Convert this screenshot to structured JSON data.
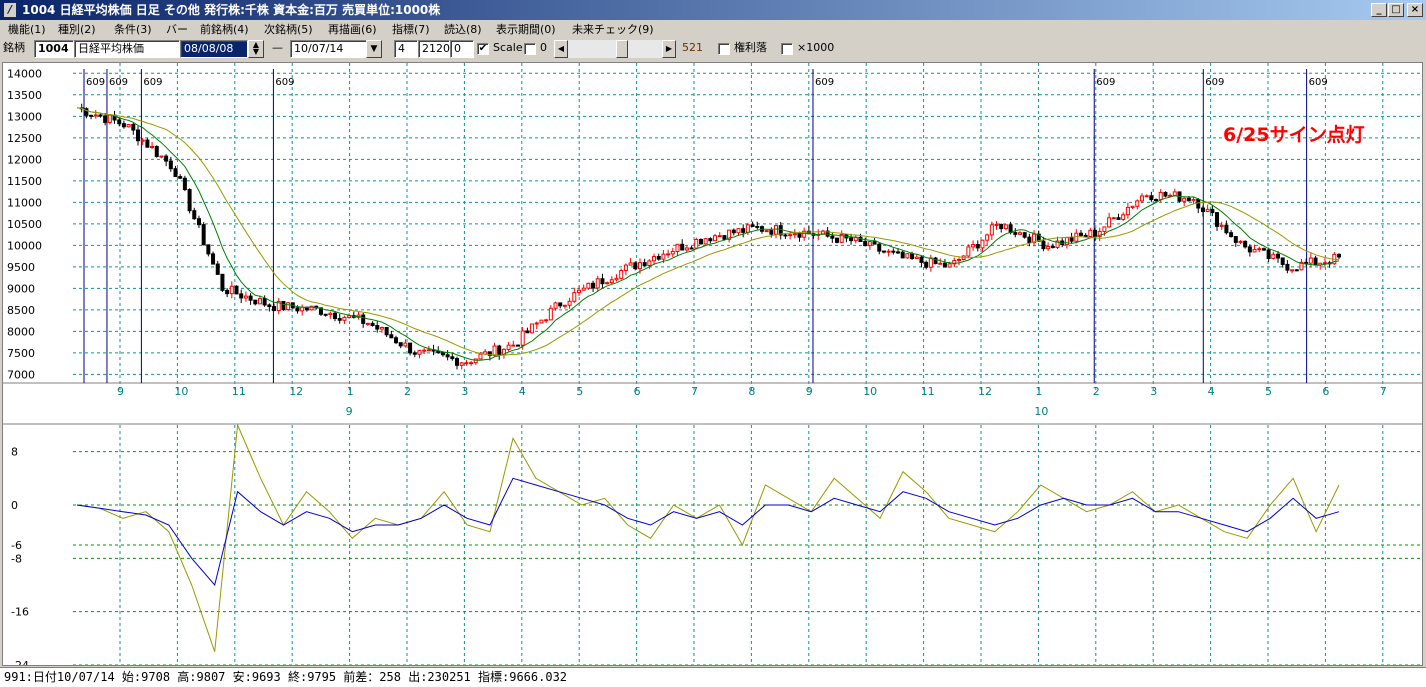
{
  "window": {
    "title": "1004 日経平均株価  日足  その他  発行株:千株  資本金:百万  売買単位:1000株",
    "icon": "chart-app-icon",
    "controls": {
      "minimize": "_",
      "restore": "□",
      "close": "×"
    }
  },
  "menu": [
    "機能(1)",
    "種別(2)",
    "条件(3)",
    "バー",
    "前銘柄(4)",
    "次銘柄(5)",
    "再描画(6)",
    "指標(7)",
    "読込(8)",
    "表示期間(0)",
    "未来チェック(9)"
  ],
  "toolbar": {
    "label_meigara": "銘柄",
    "code": "1004",
    "name": "日経平均株価",
    "start_date": "08/08/08",
    "dash": "—",
    "end_date": "10/07/14",
    "param1": "4",
    "param2": "2120",
    "param3": "0",
    "scale_checked": "✔",
    "scale_label": "Scale",
    "scale_value": "0",
    "scroll_count": "521",
    "kenri_label": "権利落",
    "x1000_label": "×1000"
  },
  "annotation": "6/25サイン点灯",
  "status": "991:日付10/07/14 始:9708 高:9807 安:9693 終:9795 前差：258 出:230251 指標:9666.032",
  "colors": {
    "grid": "#009999",
    "up_candle": "#ff0000",
    "down_candle": "#000000",
    "ma_short": "#008000",
    "ma_long": "#999900",
    "signal_line": "#0000cc",
    "osc_fast": "#999900",
    "osc_slow": "#0000cc",
    "annotation": "#ff0000"
  },
  "chart_data": [
    {
      "type": "candlestick",
      "title": "",
      "yticks": [
        14000,
        13500,
        13000,
        12500,
        12000,
        11500,
        11000,
        10500,
        10000,
        9500,
        9000,
        8500,
        8000,
        7500,
        7000
      ],
      "ylim": [
        6800,
        14100
      ],
      "month_ticks": [
        "9",
        "10",
        "11",
        "12",
        "1",
        "2",
        "3",
        "4",
        "5",
        "6",
        "7",
        "8",
        "9",
        "10",
        "11",
        "12",
        "1",
        "2",
        "3",
        "4",
        "5",
        "6",
        "7"
      ],
      "year_labels": [
        {
          "label": "9",
          "month_index": 4
        },
        {
          "label": "10",
          "month_index": 16
        }
      ],
      "signal_markers": [
        {
          "label": "609",
          "month_pos": 0.0
        },
        {
          "label": "609",
          "month_pos": 0.4
        },
        {
          "label": "609",
          "month_pos": 1.0
        },
        {
          "label": "609",
          "month_pos": 3.3
        },
        {
          "label": "609",
          "month_pos": 12.7
        },
        {
          "label": "609",
          "month_pos": 17.6
        },
        {
          "label": "609",
          "month_pos": 19.5
        },
        {
          "label": "609",
          "month_pos": 21.3
        }
      ],
      "close_path_monthly": [
        13200,
        12800,
        11800,
        9000,
        8600,
        8500,
        8200,
        7500,
        7300,
        7700,
        8700,
        9300,
        9800,
        10200,
        10400,
        10300,
        10100,
        9700,
        9500,
        10500,
        10000,
        10300,
        11200,
        11100,
        10000,
        9500,
        9700
      ],
      "grid": true
    },
    {
      "type": "line",
      "title": "",
      "yticks": [
        8,
        0,
        -6,
        -8,
        -16,
        -24
      ],
      "ylim": [
        -24,
        12
      ],
      "series": [
        {
          "name": "",
          "values": [
            0,
            -0.5,
            -2,
            -1,
            -4,
            -12,
            -22,
            12,
            4,
            -3,
            2,
            -1,
            -5,
            -2,
            -3,
            -2,
            2,
            -3,
            -4,
            10,
            4,
            2,
            0,
            1,
            -3,
            -5,
            0,
            -2,
            0,
            -6,
            3,
            1,
            -1,
            4,
            1,
            -2,
            5,
            2,
            -2,
            -3,
            -4,
            -1,
            3,
            1,
            -1,
            0,
            2,
            -1,
            0,
            -2,
            -4,
            -5,
            0,
            4,
            -4,
            3
          ]
        },
        {
          "name": "",
          "values": [
            0,
            -0.5,
            -1,
            -1.5,
            -3,
            -8,
            -12,
            2,
            -1,
            -3,
            -1,
            -2,
            -4,
            -3,
            -3,
            -2,
            0,
            -2,
            -3,
            4,
            3,
            2,
            1,
            0,
            -2,
            -3,
            -1,
            -2,
            -1,
            -3,
            0,
            0,
            -1,
            1,
            0,
            -1,
            2,
            1,
            -1,
            -2,
            -3,
            -2,
            0,
            1,
            0,
            0,
            1,
            -1,
            -1,
            -2,
            -3,
            -4,
            -2,
            1,
            -2,
            -1
          ]
        }
      ],
      "grid": true
    }
  ]
}
